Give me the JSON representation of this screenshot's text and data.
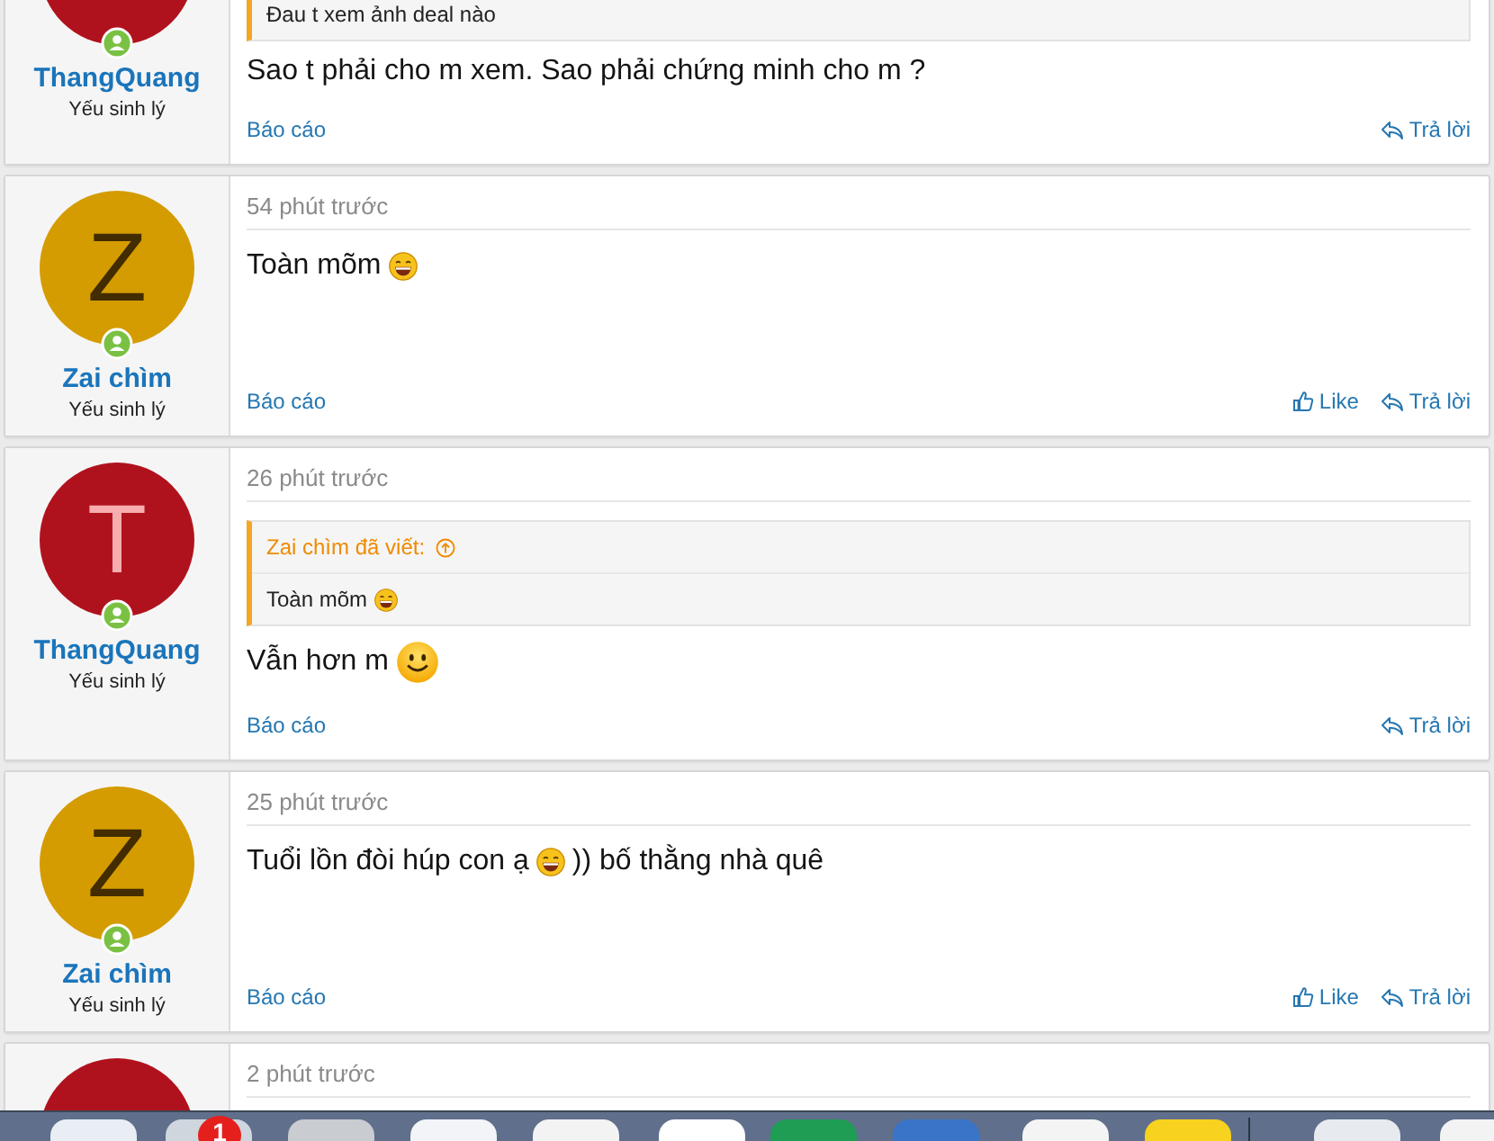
{
  "posts": [
    {
      "author": "ThangQuang",
      "user_title": "Yếu sinh lý",
      "avatar": {
        "color": "#b0121d"
      },
      "quote": {
        "parts": [
          {
            "kind": "text",
            "text": "Đau t xem ảnh deal nào"
          }
        ]
      },
      "message": [
        {
          "kind": "text",
          "text": "Sao t phải cho m xem. Sao phải chứng minh cho m ?"
        }
      ],
      "report": "Báo cáo",
      "actions": [
        {
          "kind": "reply",
          "label": "Trả lời"
        }
      ]
    },
    {
      "date": "54 phút trước",
      "author": "Zai chìm",
      "user_title": "Yếu sinh lý",
      "avatar": {
        "letter": "Z",
        "color": "#d49c00"
      },
      "message": [
        {
          "kind": "text",
          "text": "Toàn mõm"
        },
        {
          "kind": "laugh"
        }
      ],
      "report": "Báo cáo",
      "actions": [
        {
          "kind": "like",
          "label": "Like"
        },
        {
          "kind": "reply",
          "label": "Trả lời"
        }
      ]
    },
    {
      "date": "26 phút trước",
      "author": "ThangQuang",
      "user_title": "Yếu sinh lý",
      "avatar": {
        "letter": "T",
        "color": "#b0121d"
      },
      "quote": {
        "author": "Zai chìm đã viết:",
        "parts": [
          {
            "kind": "text",
            "text": "Toàn mõm"
          },
          {
            "kind": "laugh"
          }
        ]
      },
      "message": [
        {
          "kind": "text",
          "text": "Vẫn hơn m"
        },
        {
          "kind": "smile"
        }
      ],
      "report": "Báo cáo",
      "actions": [
        {
          "kind": "reply",
          "label": "Trả lời"
        }
      ]
    },
    {
      "date": "25 phút trước",
      "author": "Zai chìm",
      "user_title": "Yếu sinh lý",
      "avatar": {
        "letter": "Z",
        "color": "#d49c00"
      },
      "message": [
        {
          "kind": "text",
          "text": "Tuổi lồn đòi húp con ạ"
        },
        {
          "kind": "laugh"
        },
        {
          "kind": "text",
          "text": ")) bố thằng nhà quê"
        }
      ],
      "report": "Báo cáo",
      "actions": [
        {
          "kind": "like",
          "label": "Like"
        },
        {
          "kind": "reply",
          "label": "Trả lời"
        }
      ]
    },
    {
      "date": "2 phút trước",
      "avatar": {
        "color": "#b0121d"
      }
    }
  ],
  "dock": {
    "badge": "1"
  }
}
